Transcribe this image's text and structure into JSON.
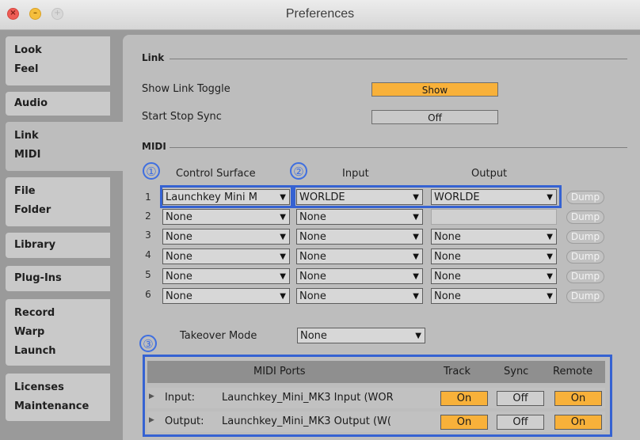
{
  "window": {
    "title": "Preferences"
  },
  "traffic_lights": {
    "close": "×",
    "minimize": "–",
    "zoom": "+"
  },
  "sidebar": {
    "tabs": [
      {
        "lines": [
          "Look",
          "Feel"
        ]
      },
      {
        "lines": [
          "Audio"
        ]
      },
      {
        "lines": [
          "Link",
          "MIDI"
        ]
      },
      {
        "lines": [
          "File",
          "Folder"
        ]
      },
      {
        "lines": [
          "Library"
        ]
      },
      {
        "lines": [
          "Plug-Ins"
        ]
      },
      {
        "lines": [
          "Record",
          "Warp",
          "Launch"
        ]
      },
      {
        "lines": [
          "Licenses",
          "Maintenance"
        ]
      }
    ]
  },
  "link": {
    "section": "Link",
    "show_toggle_label": "Show Link Toggle",
    "show_toggle_value": "Show",
    "start_stop_label": "Start Stop Sync",
    "start_stop_value": "Off"
  },
  "midi": {
    "section": "MIDI",
    "col_control_surface": "Control Surface",
    "col_input": "Input",
    "col_output": "Output",
    "dump_label": "Dump",
    "rows": [
      {
        "num": "1",
        "surface": "Launchkey Mini M",
        "input": "WORLDE",
        "output": "WORLDE"
      },
      {
        "num": "2",
        "surface": "None",
        "input": "None",
        "output": ""
      },
      {
        "num": "3",
        "surface": "None",
        "input": "None",
        "output": "None"
      },
      {
        "num": "4",
        "surface": "None",
        "input": "None",
        "output": "None"
      },
      {
        "num": "5",
        "surface": "None",
        "input": "None",
        "output": "None"
      },
      {
        "num": "6",
        "surface": "None",
        "input": "None",
        "output": "None"
      }
    ],
    "takeover_label": "Takeover Mode",
    "takeover_value": "None"
  },
  "annotations": [
    "①",
    "②",
    "③"
  ],
  "ports": {
    "header": {
      "ports": "MIDI Ports",
      "track": "Track",
      "sync": "Sync",
      "remote": "Remote"
    },
    "rows": [
      {
        "kind": "Input:",
        "name": "Launchkey_Mini_MK3 Input (WOR",
        "track": "On",
        "sync": "Off",
        "remote": "On"
      },
      {
        "kind": "Output:",
        "name": "Launchkey_Mini_MK3 Output (W(",
        "track": "On",
        "sync": "Off",
        "remote": "On"
      }
    ]
  },
  "colors": {
    "accent": "#f8b13a",
    "highlight": "#3562d2",
    "panel": "#bdbdbd"
  }
}
